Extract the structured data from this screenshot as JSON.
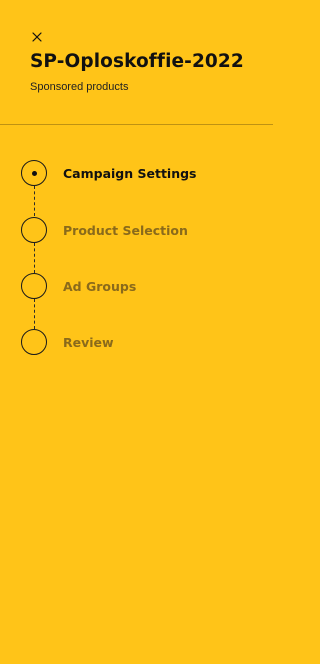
{
  "header": {
    "title": "SP-Oploskoffie-2022",
    "subtitle": "Sponsored products"
  },
  "close": {
    "icon": "close-icon",
    "symbol": "×"
  },
  "steps": [
    {
      "label": "Campaign Settings",
      "state": "active"
    },
    {
      "label": "Product Selection",
      "state": "inactive"
    },
    {
      "label": "Ad Groups",
      "state": "inactive"
    },
    {
      "label": "Review",
      "state": "inactive"
    }
  ],
  "colors": {
    "background": "#FFC418",
    "active_text": "#111111",
    "inactive_text": "#8A6A1B"
  }
}
